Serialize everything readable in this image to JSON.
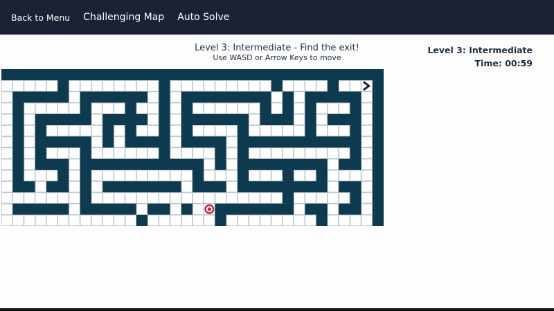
{
  "nav": {
    "back_label": "Back to Menu",
    "map_label": "Challenging Map",
    "solve_label": "Auto Solve"
  },
  "instructions": {
    "title": "Level 3: Intermediate - Find the exit!",
    "subtitle": "Use WASD or Arrow Keys to move"
  },
  "status": {
    "level": "Level 3: Intermediate",
    "time": "Time: 00:59"
  },
  "maze": {
    "cols": 34,
    "rows": 14,
    "wall_color": "#0d3a4e",
    "path_color": "#ffffff",
    "grid_color": "#b7c3cb",
    "player_icon": "target-icon",
    "player_color": "#c0283c",
    "exit_icon": "chevron-right-icon",
    "exit_color": "#2a1a3a",
    "player": [
      18,
      12
    ],
    "exit": [
      32,
      1
    ],
    "grid": [
      "1111111111111111111111111111111111",
      "0000010000000010000000001000010001",
      "0111110111111010111111110101111101",
      "0100000100010010100000010101000101",
      "0101111101111010111111011101011101",
      "0101000001010010100001000001000101",
      "0101111101011110111101111111111101",
      "0101000100000010000101000000000101",
      "0101110111111111110101111111101101",
      "0100010100000000010001000100100001",
      "0110110101111111011101111111101101",
      "0000000100000000000000000100000101",
      "0111110111110110100111111101101101",
      "0000000000001000000100000000100001"
    ]
  }
}
